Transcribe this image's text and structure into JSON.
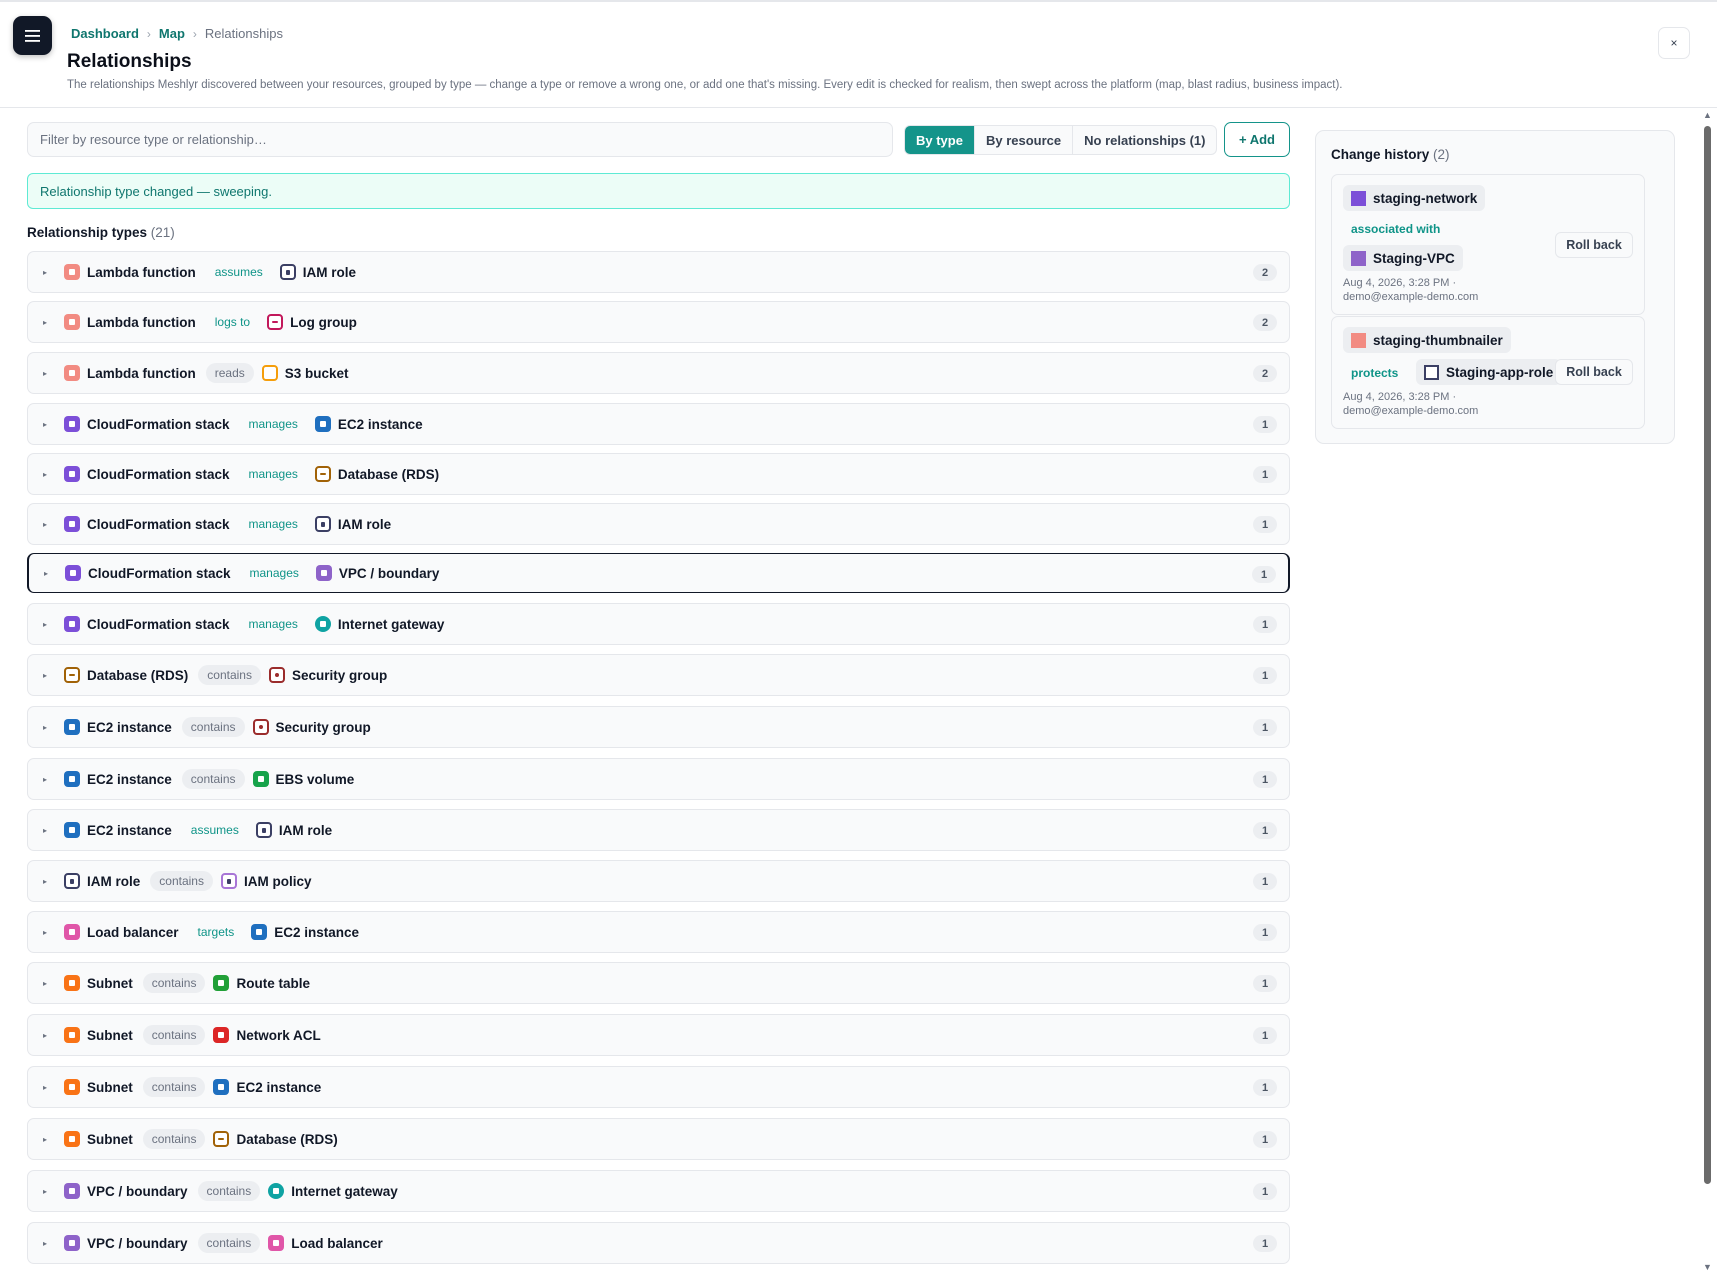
{
  "header": {
    "breadcrumb": [
      "Dashboard",
      "Map",
      "Relationships"
    ],
    "title": "Relationships",
    "description": "The relationships Meshlyr discovered between your resources, grouped by type — change a type or remove a wrong one, or add one that's missing. Every edit is checked for realism, then swept across the platform (map, blast radius, business impact).",
    "close_label": "×"
  },
  "toolbar": {
    "filter_placeholder": "Filter by resource type or relationship…",
    "view_by_type": "By type",
    "view_by_resource": "By resource",
    "view_no_relationships": "No relationships (1)",
    "add_label": "+ Add",
    "active_view": "By type"
  },
  "notice": "Relationship type changed — sweeping.",
  "relationship_types": {
    "title": "Relationship types",
    "count": "(21)",
    "rows": [
      {
        "source": "Lambda function",
        "source_icon": "lambda",
        "relation": "assumes",
        "relation_style": "teal",
        "target": "IAM role",
        "target_icon": "iam",
        "count": "2"
      },
      {
        "source": "Lambda function",
        "source_icon": "lambda",
        "relation": "logs to",
        "relation_style": "teal",
        "target": "Log group",
        "target_icon": "log",
        "count": "2"
      },
      {
        "source": "Lambda function",
        "source_icon": "lambda",
        "relation": "reads",
        "relation_style": "gray",
        "target": "S3 bucket",
        "target_icon": "s3",
        "count": "2"
      },
      {
        "source": "CloudFormation stack",
        "source_icon": "cfn",
        "relation": "manages",
        "relation_style": "teal",
        "target": "EC2 instance",
        "target_icon": "ec2",
        "count": "1"
      },
      {
        "source": "CloudFormation stack",
        "source_icon": "cfn",
        "relation": "manages",
        "relation_style": "teal",
        "target": "Database (RDS)",
        "target_icon": "rds",
        "count": "1"
      },
      {
        "source": "CloudFormation stack",
        "source_icon": "cfn",
        "relation": "manages",
        "relation_style": "teal",
        "target": "IAM role",
        "target_icon": "iam",
        "count": "1"
      },
      {
        "source": "CloudFormation stack",
        "source_icon": "cfn",
        "relation": "manages",
        "relation_style": "teal",
        "target": "VPC / boundary",
        "target_icon": "vpc",
        "count": "1"
      },
      {
        "source": "CloudFormation stack",
        "source_icon": "cfn",
        "relation": "manages",
        "relation_style": "teal",
        "target": "Internet gateway",
        "target_icon": "igw",
        "count": "1"
      },
      {
        "source": "Database (RDS)",
        "source_icon": "rds",
        "relation": "contains",
        "relation_style": "gray",
        "target": "Security group",
        "target_icon": "sg",
        "count": "1"
      },
      {
        "source": "EC2 instance",
        "source_icon": "ec2",
        "relation": "contains",
        "relation_style": "gray",
        "target": "Security group",
        "target_icon": "sg",
        "count": "1"
      },
      {
        "source": "EC2 instance",
        "source_icon": "ec2",
        "relation": "contains",
        "relation_style": "gray",
        "target": "EBS volume",
        "target_icon": "ebs",
        "count": "1"
      },
      {
        "source": "EC2 instance",
        "source_icon": "ec2",
        "relation": "assumes",
        "relation_style": "teal",
        "target": "IAM role",
        "target_icon": "iam",
        "count": "1"
      },
      {
        "source": "IAM role",
        "source_icon": "iam",
        "relation": "contains",
        "relation_style": "gray",
        "target": "IAM policy",
        "target_icon": "policy",
        "count": "1"
      },
      {
        "source": "Load balancer",
        "source_icon": "lb",
        "relation": "targets",
        "relation_style": "teal",
        "target": "EC2 instance",
        "target_icon": "ec2",
        "count": "1"
      },
      {
        "source": "Subnet",
        "source_icon": "subnet",
        "relation": "contains",
        "relation_style": "gray",
        "target": "Route table",
        "target_icon": "rt",
        "count": "1"
      },
      {
        "source": "Subnet",
        "source_icon": "subnet",
        "relation": "contains",
        "relation_style": "gray",
        "target": "Network ACL",
        "target_icon": "nacl",
        "count": "1"
      },
      {
        "source": "Subnet",
        "source_icon": "subnet",
        "relation": "contains",
        "relation_style": "gray",
        "target": "EC2 instance",
        "target_icon": "ec2",
        "count": "1"
      },
      {
        "source": "Subnet",
        "source_icon": "subnet",
        "relation": "contains",
        "relation_style": "gray",
        "target": "Database (RDS)",
        "target_icon": "rds",
        "count": "1"
      },
      {
        "source": "VPC / boundary",
        "source_icon": "vpc",
        "relation": "contains",
        "relation_style": "gray",
        "target": "Internet gateway",
        "target_icon": "igw",
        "count": "1"
      },
      {
        "source": "VPC / boundary",
        "source_icon": "vpc",
        "relation": "contains",
        "relation_style": "gray",
        "target": "Load balancer",
        "target_icon": "lb",
        "count": "1"
      }
    ]
  },
  "change_history": {
    "title": "Change history",
    "count": "(2)",
    "entries": [
      {
        "source": "staging-network",
        "source_icon": "cfn",
        "relation": "associated with",
        "target": "Staging-VPC",
        "target_icon": "vpc",
        "meta": "Aug 4, 2026, 3:28 PM · demo@example-demo.com",
        "rollback_label": "Roll back"
      },
      {
        "source": "staging-thumbnailer",
        "source_icon": "lambda",
        "relation": "protects",
        "target": "Staging-app-role",
        "target_icon": "iam",
        "meta": "Aug 4, 2026, 3:28 PM · demo@example-demo.com",
        "rollback_label": "Roll back"
      }
    ]
  },
  "colors": {
    "accent": "#14948a",
    "notice_bg": "#ecfdf7",
    "notice_border": "#5eead4"
  }
}
